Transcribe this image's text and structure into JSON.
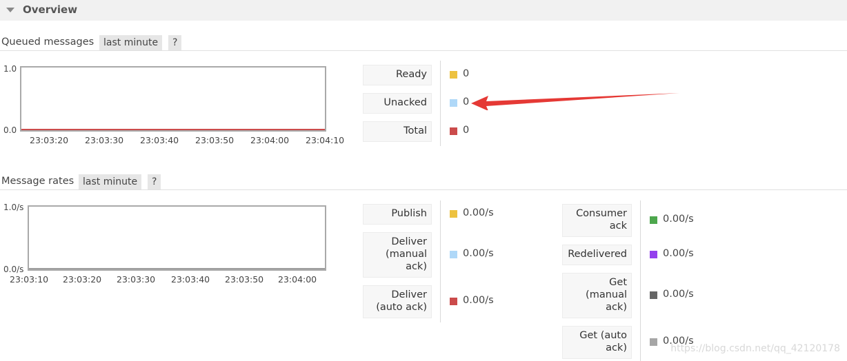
{
  "overview": {
    "title": "Overview"
  },
  "queued": {
    "label": "Queued messages",
    "range": "last minute",
    "help": "?",
    "chart": {
      "y_max": "1.0",
      "y_min": "0.0",
      "ticks": [
        "23:03:20",
        "23:03:30",
        "23:03:40",
        "23:03:50",
        "23:04:00",
        "23:04:10"
      ]
    },
    "legend": [
      {
        "label": "Ready",
        "value": "0",
        "color": "#edc240"
      },
      {
        "label": "Unacked",
        "value": "0",
        "color": "#afd8f8"
      },
      {
        "label": "Total",
        "value": "0",
        "color": "#cb4b4b"
      }
    ]
  },
  "rates": {
    "label": "Message rates",
    "range": "last minute",
    "help": "?",
    "chart": {
      "y_max": "1.0/s",
      "y_min": "0.0/s",
      "ticks": [
        "23:03:10",
        "23:03:20",
        "23:03:30",
        "23:03:40",
        "23:03:50",
        "23:04:00"
      ]
    },
    "left": [
      {
        "label": "Publish",
        "value": "0.00/s",
        "color": "#edc240"
      },
      {
        "label": "Deliver\n(manual\nack)",
        "value": "0.00/s",
        "color": "#afd8f8"
      },
      {
        "label": "Deliver\n(auto ack)",
        "value": "0.00/s",
        "color": "#cb4b4b"
      }
    ],
    "right": [
      {
        "label": "Consumer\nack",
        "value": "0.00/s",
        "color": "#4da74d"
      },
      {
        "label": "Redelivered",
        "value": "0.00/s",
        "color": "#9440ed"
      },
      {
        "label": "Get\n(manual\nack)",
        "value": "0.00/s",
        "color": "#666666"
      },
      {
        "label": "Get (auto\nack)",
        "value": "0.00/s",
        "color": "#a6a6a6"
      }
    ]
  },
  "watermark": "https://blog.csdn.net/qq_42120178"
}
